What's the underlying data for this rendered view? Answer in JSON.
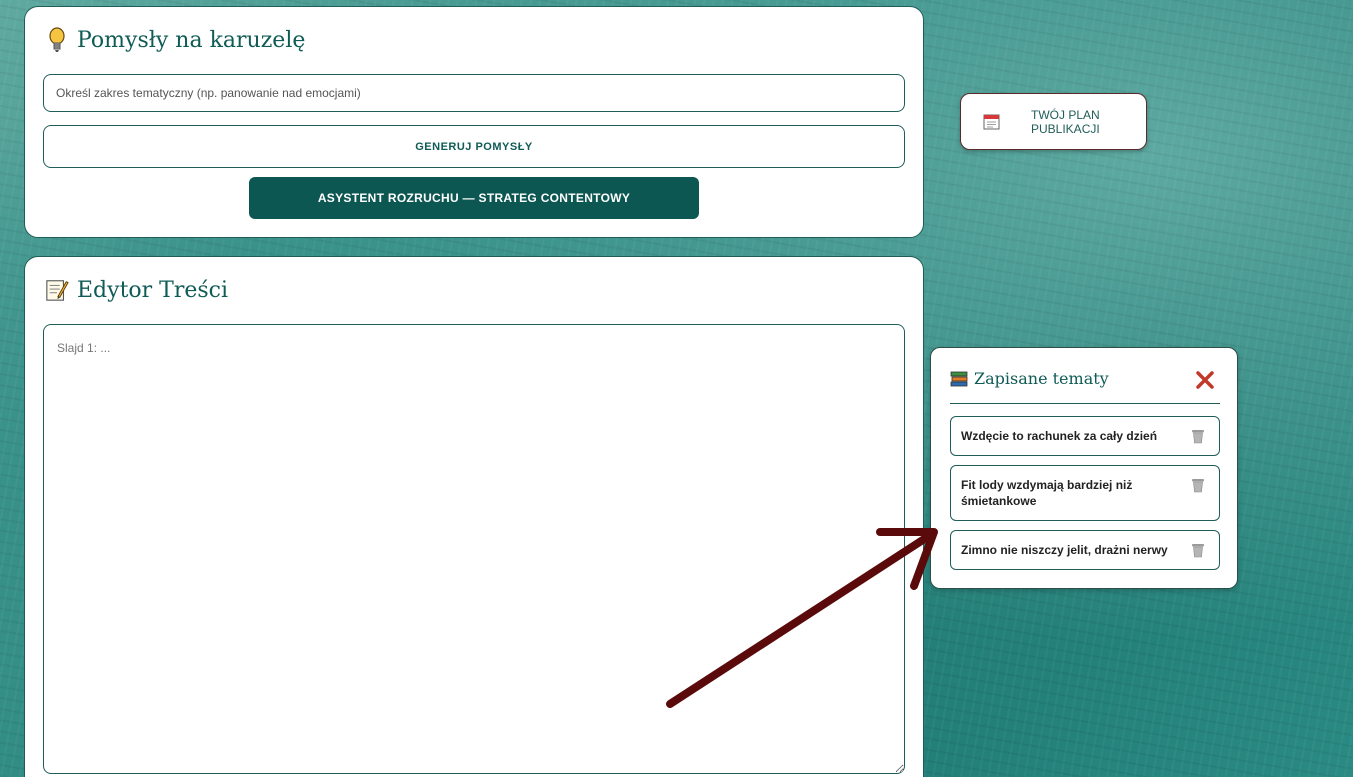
{
  "ideas": {
    "title": "Pomysły na karuzelę",
    "icon": "lightbulb-icon",
    "input_placeholder": "Określ zakres tematyczny (np. panowanie nad emocjami)",
    "input_value": "",
    "generate_label": "GENERUJ POMYSŁY",
    "assistant_label": "ASYSTENT ROZRUCHU — STRATEG CONTENTOWY"
  },
  "editor": {
    "title": "Edytor Treści",
    "icon": "memo-icon",
    "placeholder": "Slajd 1: ...",
    "value": ""
  },
  "plan": {
    "label": "TWÓJ PLAN PUBLIKACJI",
    "icon": "calendar-icon"
  },
  "saved": {
    "title": "Zapisane tematy",
    "icon": "books-icon",
    "items": [
      {
        "label": "Wzdęcie to rachunek za cały dzień"
      },
      {
        "label": "Fit lody wzdymają bardziej niż śmietankowe"
      },
      {
        "label": "Zimno nie niszczy jelit, drażni nerwy"
      }
    ]
  },
  "colors": {
    "primary": "#0d5753",
    "accent_text": "#0f5b55",
    "close": "#c0392b",
    "arrow": "#5a0a0a"
  }
}
